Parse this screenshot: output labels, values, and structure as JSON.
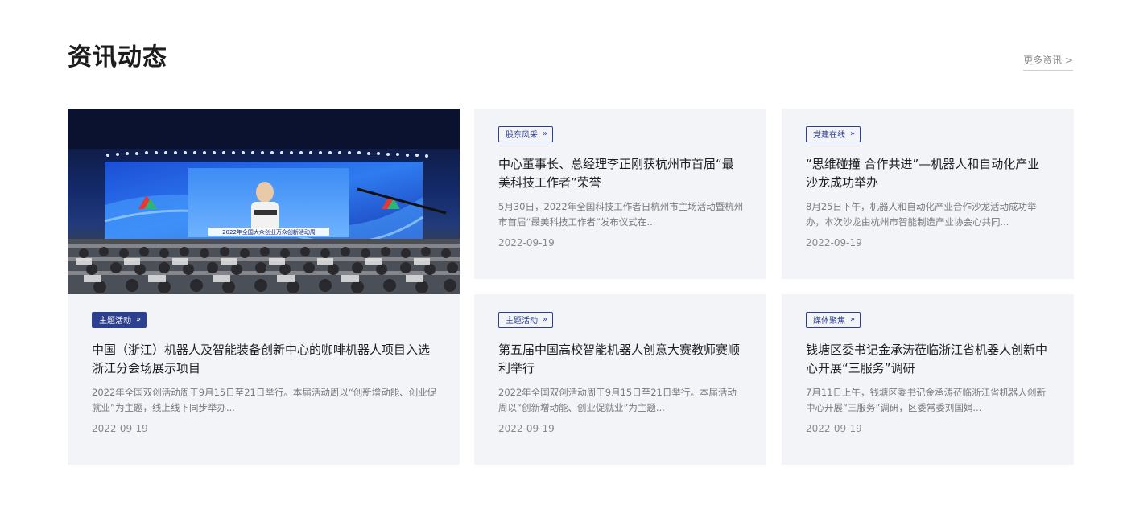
{
  "section": {
    "title": "资讯动态",
    "more_label": "更多资讯 >"
  },
  "featured": {
    "tag": "主题活动",
    "chevron": "»",
    "title": "中国（浙江）机器人及智能装备创新中心的咖啡机器人项目入选浙江分会场展示项目",
    "desc": "2022年全国双创活动周于9月15日至21日举行。本届活动周以“创新增动能、创业促就业”为主题，线上线下同步举办...",
    "date": "2022-09-19",
    "image_banner_text": "2022年全国大众创业万众创新活动周"
  },
  "cards": [
    {
      "tag": "股东风采",
      "chevron": "»",
      "title": "中心董事长、总经理李正刚获杭州市首届“最美科技工作者”荣誉",
      "desc": "5月30日，2022年全国科技工作者日杭州市主场活动暨杭州市首届“最美科技工作者”发布仪式在...",
      "date": "2022-09-19"
    },
    {
      "tag": "党建在线",
      "chevron": "»",
      "title": "“思维碰撞 合作共进”—机器人和自动化产业沙龙成功举办",
      "desc": "8月25日下午，机器人和自动化产业合作沙龙活动成功举办，本次沙龙由杭州市智能制造产业协会心共同...",
      "date": "2022-09-19"
    },
    {
      "tag": "主题活动",
      "chevron": "»",
      "title": "第五届中国高校智能机器人创意大赛教师赛顺利举行",
      "desc": "2022年全国双创活动周于9月15日至21日举行。本届活动周以“创新增动能、创业促就业”为主题...",
      "date": "2022-09-19"
    },
    {
      "tag": "媒体聚焦",
      "chevron": "»",
      "title": "钱塘区委书记金承涛莅临浙江省机器人创新中心开展“三服务”调研",
      "desc": "7月11日上午，钱塘区委书记金承涛莅临浙江省机器人创新中心开展“三服务”调研，区委常委刘国娟...",
      "date": "2022-09-19"
    }
  ],
  "colors": {
    "accent": "#2d3f8f",
    "card_bg": "#f3f4f8",
    "text_muted": "#7a7a7a"
  }
}
